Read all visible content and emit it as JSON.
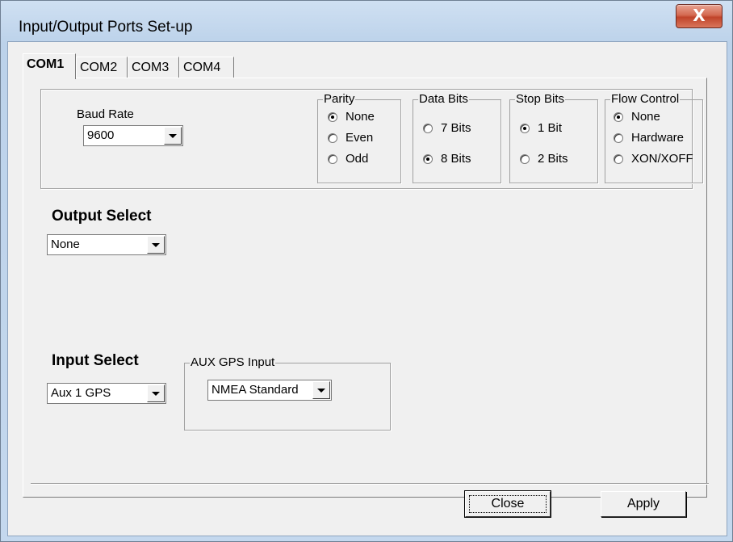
{
  "window": {
    "title": "Input/Output Ports Set-up",
    "close_glyph": "X"
  },
  "tabs": [
    {
      "label": "COM1",
      "active": true
    },
    {
      "label": "COM2",
      "active": false
    },
    {
      "label": "COM3",
      "active": false
    },
    {
      "label": "COM4",
      "active": false
    }
  ],
  "baud": {
    "label": "Baud Rate",
    "value": "9600"
  },
  "parity": {
    "legend": "Parity",
    "options": [
      "None",
      "Even",
      "Odd"
    ],
    "selected": "None"
  },
  "data_bits": {
    "legend": "Data Bits",
    "options": [
      "7 Bits",
      "8 Bits"
    ],
    "selected": "8 Bits"
  },
  "stop_bits": {
    "legend": "Stop Bits",
    "options": [
      "1 Bit",
      "2 Bits"
    ],
    "selected": "1 Bit"
  },
  "flow_control": {
    "legend": "Flow Control",
    "options": [
      "None",
      "Hardware",
      "XON/XOFF"
    ],
    "selected": "None"
  },
  "output_select": {
    "label": "Output Select",
    "value": "None"
  },
  "input_select": {
    "label": "Input Select",
    "value": "Aux 1 GPS"
  },
  "aux_gps": {
    "legend": "AUX GPS Input",
    "value": "NMEA Standard"
  },
  "buttons": {
    "close": "Close",
    "apply": "Apply"
  },
  "colors": {
    "dialog_bg": "#f0f0f0",
    "title_close_red": "#c0432a",
    "frame_blue": "#c4d8ee"
  }
}
